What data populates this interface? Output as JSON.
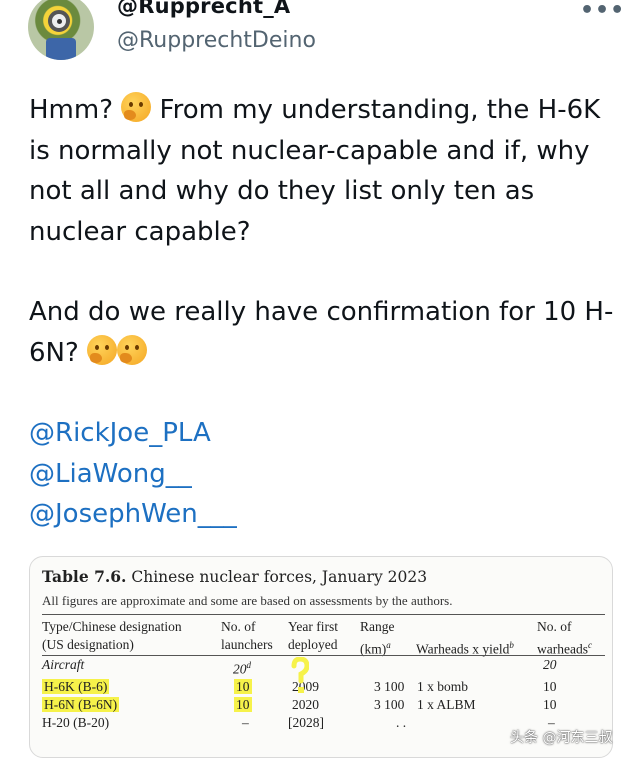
{
  "author": {
    "display_name": "@Rupprecht_A",
    "handle": "@RupprechtDeino",
    "more_label": "•••"
  },
  "tweet": {
    "paragraph1_a": "Hmm? ",
    "paragraph1_b": " From my understanding, the H-6K is normally not nuclear-capable and if, why not all and why do they list only ten as nuclear capable?",
    "paragraph2_a": "And do we really have confirmation for 10 H-6N? ",
    "mentions": [
      "@RickJoe_PLA",
      "@LiaWong__",
      "@JosephWen___"
    ]
  },
  "table": {
    "title_bold": "Table 7.6.",
    "title_rest": " Chinese nuclear forces, January 2023",
    "note": "All figures are approximate and some are based on assessments by the authors.",
    "headers": {
      "type_1": "Type/Chinese designation",
      "type_2": "(US designation)",
      "launchers_1": "No. of",
      "launchers_2": "launchers",
      "year_1": "Year first",
      "year_2": "deployed",
      "range_1": "Range",
      "range_2": "(km)",
      "range_sup": "a",
      "warheads_yield": "Warheads x yield",
      "warheads_yield_sup": "b",
      "nwarheads_1": "No. of",
      "nwarheads_2": "warheads",
      "nwarheads_sup": "c"
    },
    "section": {
      "label": "Aircraft",
      "launchers": "20",
      "launchers_sup": "d",
      "warheads": "20"
    },
    "rows": [
      {
        "type": "H-6K (B-6)",
        "launchers": "10",
        "year": "2009",
        "range": "3 100",
        "yield": "1 x bomb",
        "warheads": "10"
      },
      {
        "type": "H-6N (B-6N)",
        "launchers": "10",
        "year": "2020",
        "range": "3 100",
        "yield": "1 x ALBM",
        "warheads": "10"
      },
      {
        "type": "H-20 (B-20)",
        "launchers": "–",
        "year": "[2028]",
        "range": ". .",
        "yield": "",
        "warheads": "–"
      }
    ]
  },
  "watermark": "头条 @河东三叔",
  "colors": {
    "mention": "#1d70c2",
    "highlight": "#f6f24a",
    "handle": "#536471"
  }
}
